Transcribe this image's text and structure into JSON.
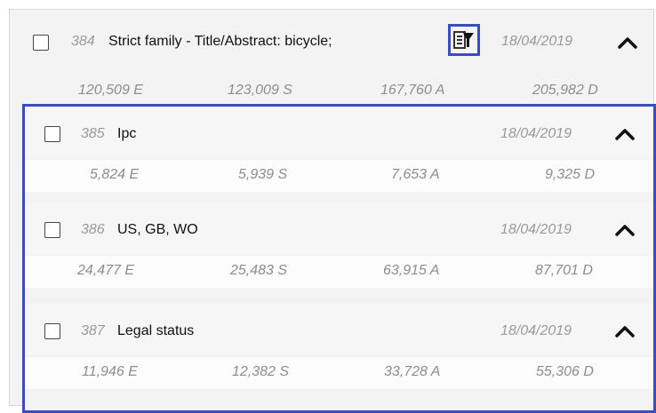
{
  "parent": {
    "number": "384",
    "title": "Strict family - Title/Abstract: bicycle;",
    "date": "18/04/2019",
    "stats": [
      "120,509 E",
      "123,009 S",
      "167,760 A",
      "205,982 D"
    ]
  },
  "children": [
    {
      "number": "385",
      "title": "Ipc",
      "date": "18/04/2019",
      "stats": [
        "5,824 E",
        "5,939 S",
        "7,653 A",
        "9,325 D"
      ]
    },
    {
      "number": "386",
      "title": "US, GB, WO",
      "date": "18/04/2019",
      "stats": [
        "24,477 E",
        "25,483 S",
        "63,915 A",
        "87,701 D"
      ]
    },
    {
      "number": "387",
      "title": "Legal status",
      "date": "18/04/2019",
      "stats": [
        "11,946 E",
        "12,382 S",
        "33,728 A",
        "55,306 D"
      ]
    }
  ],
  "icons": {
    "filter": "filter-icon",
    "collapse": "chevron-up-icon"
  },
  "colors": {
    "highlight": "#3b4bc0"
  }
}
